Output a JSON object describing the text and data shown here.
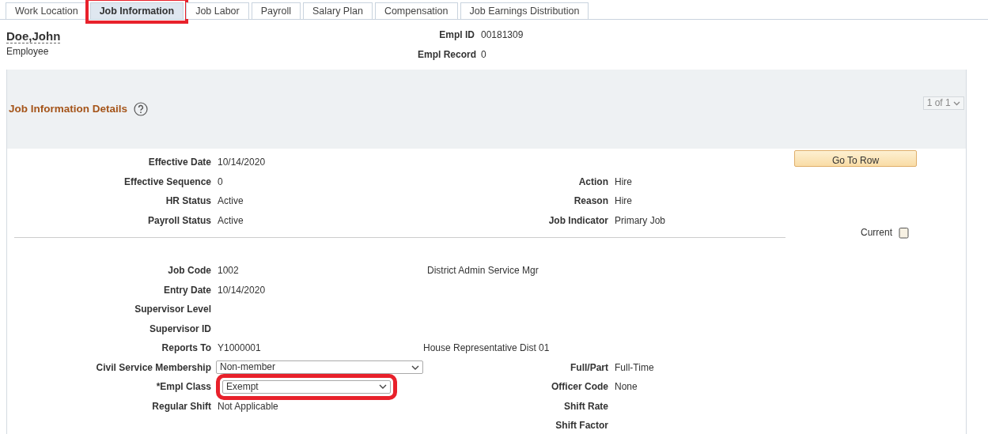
{
  "tabs": [
    {
      "label": "Work Location",
      "selected": false,
      "highlighted": false
    },
    {
      "label": "Job Information",
      "selected": true,
      "highlighted": true
    },
    {
      "label": "Job Labor",
      "selected": false,
      "highlighted": false
    },
    {
      "label": "Payroll",
      "selected": false,
      "highlighted": false
    },
    {
      "label": "Salary Plan",
      "selected": false,
      "highlighted": false
    },
    {
      "label": "Compensation",
      "selected": false,
      "highlighted": false
    },
    {
      "label": "Job Earnings Distribution",
      "selected": false,
      "highlighted": false
    }
  ],
  "employee": {
    "name": "Doe,John",
    "role": "Employee",
    "ids": [
      {
        "label": "Empl ID",
        "value": "00181309"
      },
      {
        "label": "Empl Record",
        "value": "0"
      }
    ]
  },
  "section": {
    "title": "Job Information Details",
    "pager": "1 of 1",
    "button": "Go To Row",
    "current_label": "Current",
    "top_rows": [
      {
        "label": "Effective Date",
        "value": "10/14/2020"
      },
      {
        "label": "Effective Sequence",
        "value": "0",
        "right_label": "Action",
        "right_value": "Hire"
      },
      {
        "label": "HR Status",
        "value": "Active",
        "right_label": "Reason",
        "right_value": "Hire"
      },
      {
        "label": "Payroll Status",
        "value": "Active",
        "right_label": "Job Indicator",
        "right_value": "Primary Job"
      }
    ],
    "rows": [
      {
        "kind": "text",
        "label": "Job Code",
        "value": "1002",
        "description": "District Admin Service Mgr"
      },
      {
        "kind": "text",
        "label": "Entry Date",
        "value": "10/14/2020"
      },
      {
        "kind": "text",
        "label": "Supervisor Level"
      },
      {
        "kind": "text",
        "label": "Supervisor ID"
      },
      {
        "kind": "text",
        "label": "Reports To",
        "value": "Y1000001",
        "description": "House Representative Dist 01"
      },
      {
        "kind": "select",
        "label": "Civil Service Membership",
        "value": "Non-member",
        "right_label": "Full/Part",
        "right_value": "Full-Time",
        "highlighted": false
      },
      {
        "kind": "select",
        "label": "*Empl Class",
        "value": "Exempt",
        "right_label": "Officer Code",
        "right_value": "None",
        "highlighted": true
      },
      {
        "kind": "text",
        "label": "Regular Shift",
        "value": "Not Applicable",
        "right_label": "Shift Rate"
      },
      {
        "kind": "blank",
        "right_label": "Shift Factor"
      }
    ]
  }
}
